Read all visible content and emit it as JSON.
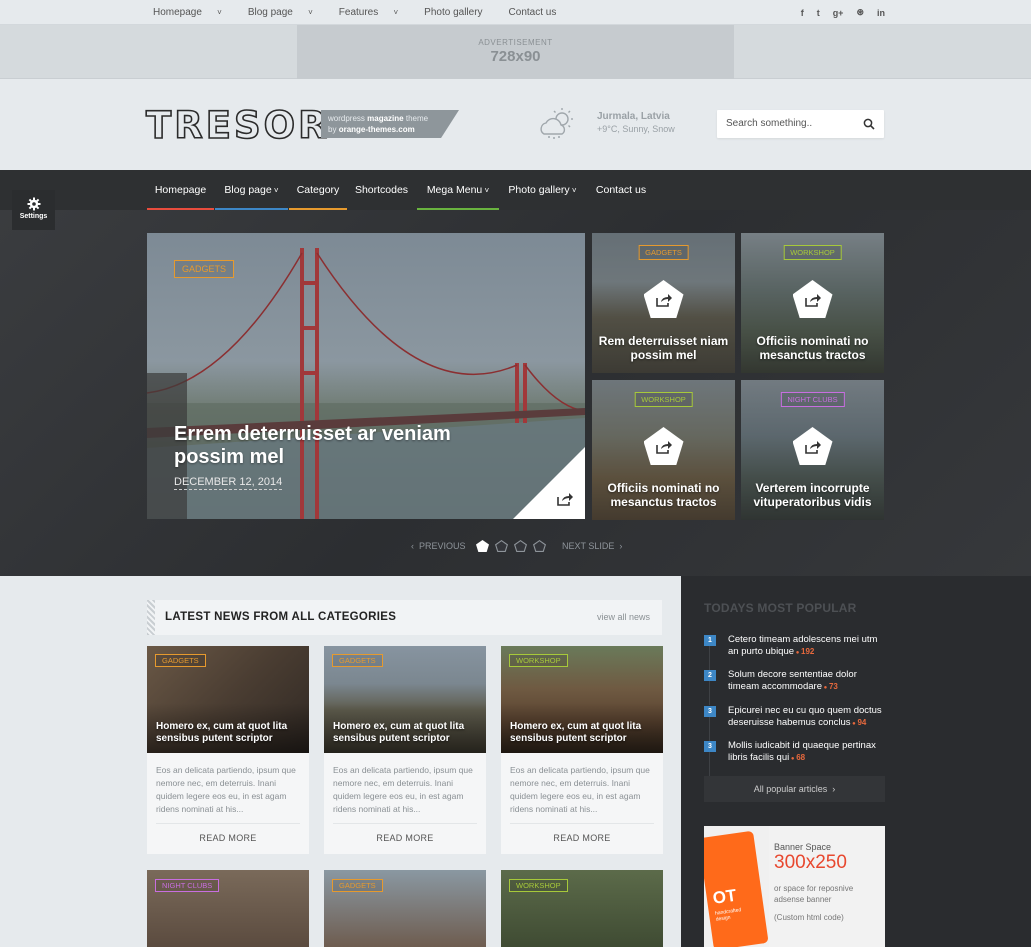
{
  "topnav": {
    "items": [
      "Homepage",
      "Blog page",
      "Features",
      "Photo gallery",
      "Contact us"
    ],
    "dropdown_flags": [
      true,
      true,
      true,
      false,
      false
    ],
    "social_icons": [
      "facebook-icon",
      "twitter-icon",
      "google-plus-icon",
      "dribbble-icon",
      "linkedin-icon"
    ],
    "social_glyphs": [
      "f",
      "t",
      "g+",
      "⊛",
      "in"
    ]
  },
  "ad": {
    "label": "ADVERTISEMENT",
    "size": "728x90"
  },
  "header": {
    "logo": "TRESOR",
    "tagline_pre": "wordpress",
    "tagline_bold": "magazine",
    "tagline_post": "theme",
    "tagline_line2_pre": "by",
    "tagline_line2_bold": "orange-themes.com",
    "weather_city": "Jurmala, Latvia",
    "weather_desc": "+9°C, Sunny, Snow",
    "search_placeholder": "Search something.."
  },
  "settings": {
    "label": "Settings"
  },
  "mainnav": [
    {
      "label": "Homepage",
      "dropdown": false,
      "bar_color": "#e84c3d"
    },
    {
      "label": "Blog page",
      "dropdown": true,
      "bar_color": "#3d87c6"
    },
    {
      "label": "Category",
      "dropdown": false,
      "bar_color": "#e69a2e"
    },
    {
      "label": "Shortcodes",
      "dropdown": false,
      "bar_color": ""
    },
    {
      "label": "Mega Menu",
      "dropdown": true,
      "bar_color": "#69b33f"
    },
    {
      "label": "Photo gallery",
      "dropdown": true,
      "bar_color": ""
    },
    {
      "label": "Contact us",
      "dropdown": false,
      "bar_color": ""
    }
  ],
  "hero": {
    "main": {
      "badge": "GADGETS",
      "badge_color": "#e69a2e",
      "title": "Errem deterruisset ar veniam possim mel",
      "date": "DECEMBER 12, 2014"
    },
    "tiles": [
      {
        "badge": "GADGETS",
        "badge_color": "#e69a2e",
        "title": "Rem deterruisset niam possim mel"
      },
      {
        "badge": "WORKSHOP",
        "badge_color": "#a7c93a",
        "title": "Officiis nominati no mesanctus tractos"
      },
      {
        "badge": "WORKSHOP",
        "badge_color": "#a7c93a",
        "title": "Officiis nominati no mesanctus tractos"
      },
      {
        "badge": "NIGHT CLUBS",
        "badge_color": "#c86ee0",
        "title": "Verterem incorrupte vituperatoribus vidis"
      }
    ],
    "prev": "PREVIOUS",
    "next": "NEXT SLIDE",
    "active_slide": 1,
    "slide_count": 4
  },
  "news": {
    "title": "LATEST NEWS FROM ALL CATEGORIES",
    "view_all": "view all news",
    "cards": [
      {
        "badge": "GADGETS",
        "badge_color": "#e69a2e",
        "title": "Homero ex, cum at quot lita sensibus putent scriptor",
        "excerpt": "Eos an delicata partiendo, ipsum que nemore nec, em deterruis. Inani quidem legere eos eu, in est agam ridens nominati at his...",
        "more": "READ MORE"
      },
      {
        "badge": "GADGETS",
        "badge_color": "#e69a2e",
        "title": "Homero ex, cum at quot lita sensibus putent scriptor",
        "excerpt": "Eos an delicata partiendo, ipsum que nemore nec, em deterruis. Inani quidem legere eos eu, in est agam ridens nominati at his...",
        "more": "READ MORE"
      },
      {
        "badge": "WORKSHOP",
        "badge_color": "#a7c93a",
        "title": "Homero ex, cum at quot lita sensibus putent scriptor",
        "excerpt": "Eos an delicata partiendo, ipsum que nemore nec, em deterruis. Inani quidem legere eos eu, in est agam ridens nominati at his...",
        "more": "READ MORE"
      }
    ],
    "cards_row2": [
      {
        "badge": "NIGHT CLUBS",
        "badge_color": "#c86ee0"
      },
      {
        "badge": "GADGETS",
        "badge_color": "#e69a2e"
      },
      {
        "badge": "WORKSHOP",
        "badge_color": "#a7c93a"
      }
    ]
  },
  "popular": {
    "title": "TODAYS MOST POPULAR",
    "items": [
      {
        "num": "1",
        "title": "Cetero timeam adolescens mei utm an purto ubique",
        "count": "192"
      },
      {
        "num": "2",
        "title": "Solum decore sententiae dolor timeam accommodare",
        "count": "73"
      },
      {
        "num": "3",
        "title": "Epicurei nec eu cu quo quem doctus deseruisse habemus conclus",
        "count": "94"
      },
      {
        "num": "3",
        "title": "Mollis iudicabit id quaeque pertinax libris facilis qui",
        "count": "68"
      }
    ],
    "all_link": "All popular articles",
    "comment_icon": "comment-icon"
  },
  "banner": {
    "title": "Banner Space",
    "size": "300x250",
    "line1": "or space for reposnive",
    "line2": "adsense banner",
    "line3": "(Custom html code)",
    "phone_logo": "OT",
    "phone_text": "handcrafted design"
  },
  "colors": {
    "accent_orange": "#e69a2e",
    "accent_blue": "#3d87c6",
    "accent_red": "#e84c3d",
    "accent_green": "#69b33f",
    "comment_red": "#e8693d"
  }
}
